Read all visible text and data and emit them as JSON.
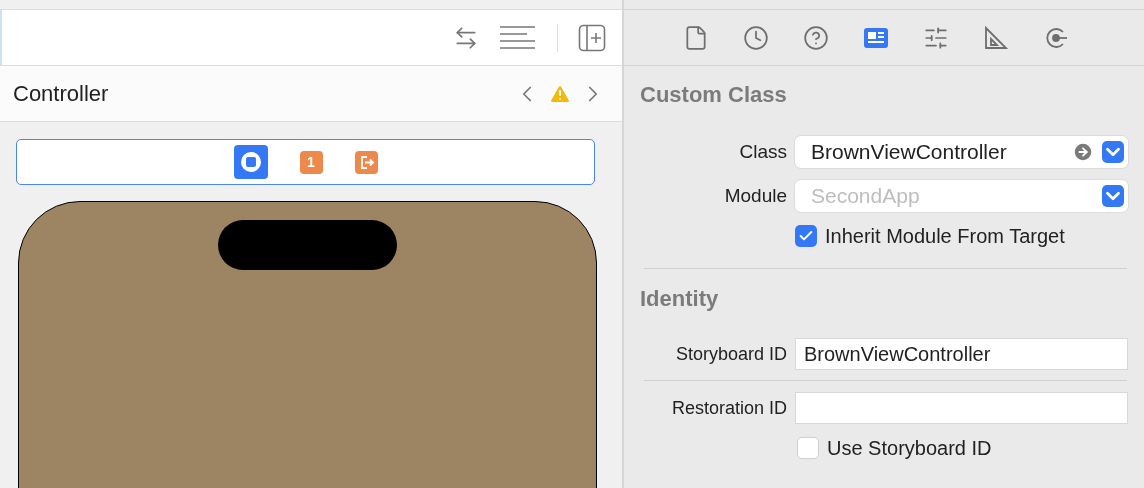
{
  "editor": {
    "title": "Controller",
    "scene_dock": {
      "first_responder_label": "1"
    }
  },
  "inspector": {
    "tabs": [
      {
        "kind": "file",
        "selected": false
      },
      {
        "kind": "history",
        "selected": false
      },
      {
        "kind": "help",
        "selected": false
      },
      {
        "kind": "identity",
        "selected": true
      },
      {
        "kind": "attributes",
        "selected": false
      },
      {
        "kind": "size",
        "selected": false
      },
      {
        "kind": "connections",
        "selected": false
      }
    ],
    "custom_class": {
      "heading": "Custom Class",
      "class": {
        "label": "Class",
        "value": "BrownViewController"
      },
      "module": {
        "label": "Module",
        "placeholder": "SecondApp"
      },
      "inherit": {
        "label": "Inherit Module From Target",
        "checked": true
      }
    },
    "identity": {
      "heading": "Identity",
      "storyboard_id": {
        "label": "Storyboard ID",
        "value": "BrownViewController"
      },
      "restoration_id": {
        "label": "Restoration ID"
      },
      "use_storyboard_id": {
        "label": "Use Storyboard ID",
        "checked": false
      }
    }
  }
}
